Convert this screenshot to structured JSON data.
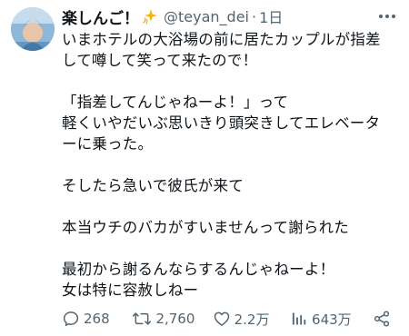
{
  "author": {
    "display_name": "楽しんご！",
    "badge_icon": "sparkle-icon",
    "handle": "@teyan_dei",
    "separator": "·",
    "time": "1日"
  },
  "body": {
    "text": "いまホテルの大浴場の前に居たカップルが指差\nして噂して笑って来たので！\n\n「指差してんじゃねーよ！」って\n軽くいやだいぶ思いきり頭突きしてエレベータ\nーに乗った。\n\nそしたら急いで彼氏が来て\n\n本当ウチのバカがすいませんって謝られた\n\n最初から謝るんならするんじゃねーよ！\n女は特に容赦しねー"
  },
  "actions": {
    "reply": {
      "icon": "reply-icon",
      "count": "268"
    },
    "retweet": {
      "icon": "retweet-icon",
      "count": "2,760"
    },
    "like": {
      "icon": "heart-icon",
      "count": "2.2万"
    },
    "views": {
      "icon": "views-icon",
      "count": "643万"
    },
    "share": {
      "icon": "share-icon"
    }
  },
  "colors": {
    "text": "#0f1419",
    "secondary": "#536471",
    "sparkle": "#f4b400"
  }
}
